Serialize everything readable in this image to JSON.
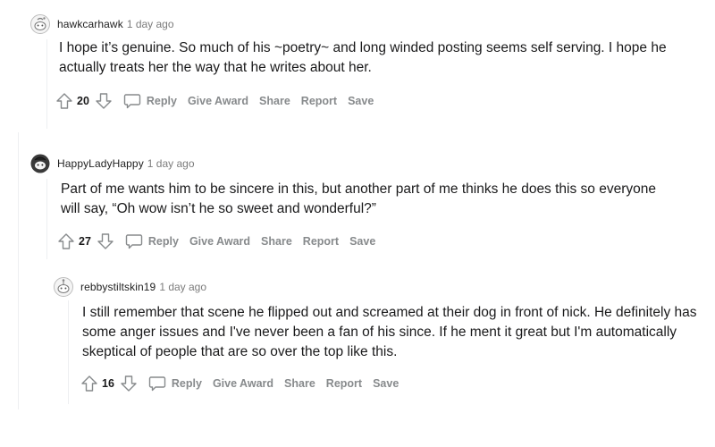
{
  "comments": [
    {
      "username": "hawkcarhawk",
      "time": "1 day ago",
      "body": "I hope it’s genuine. So much of his ~poetry~ and long winded posting seems self serving. I hope he actually treats her the way that he writes about her.",
      "score": "20"
    },
    {
      "username": "HappyLadyHappy",
      "time": "1 day ago",
      "body": "Part of me wants him to be sincere in this, but another part of me thinks he does this so everyone will say, “Oh wow isn’t he so sweet and wonderful?”",
      "score": "27"
    },
    {
      "username": "rebbystiltskin19",
      "time": "1 day ago",
      "body": "I still remember that scene he flipped out and screamed at their dog in front of nick. He definitely has some anger issues and I've never been a fan of his since. If he ment it great but I'm automatically skeptical of people that are so over the top like this.",
      "score": "16"
    }
  ],
  "actions": {
    "reply": "Reply",
    "give_award": "Give Award",
    "share": "Share",
    "report": "Report",
    "save": "Save"
  },
  "icons": {
    "upvote": "upvote-arrow-icon",
    "downvote": "downvote-arrow-icon",
    "reply": "speech-bubble-icon",
    "avatar": "snoo-avatar-icon"
  },
  "colors": {
    "action_text": "#878a8c",
    "body_text": "#1a1a1b",
    "meta_text": "#7c7c7c",
    "thread_line": "#edeff1"
  }
}
